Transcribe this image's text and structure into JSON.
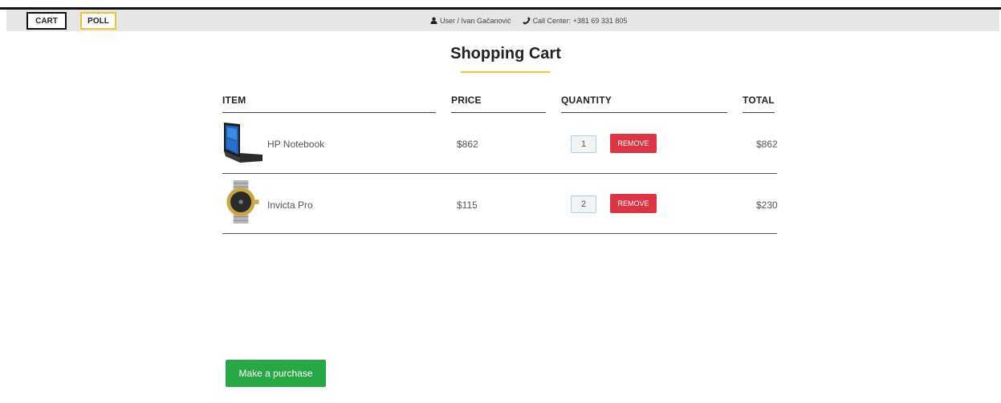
{
  "nav": {
    "cart_label": "CART",
    "poll_label": "POLL"
  },
  "contact": {
    "user_text": "User / Ivan Gačanović",
    "phone_text": "Call Center: +381 69 331 805"
  },
  "page": {
    "title": "Shopping Cart",
    "purchase_label": "Make a purchase"
  },
  "table": {
    "headers": [
      "ITEM",
      "PRICE",
      "QUANTITY",
      "TOTAL"
    ],
    "rows": [
      {
        "name": "HP Notebook",
        "price": "$862",
        "quantity": "1",
        "remove_label": "REMOVE",
        "total": "$862",
        "image": "laptop-image"
      },
      {
        "name": "Invicta Pro",
        "price": "$115",
        "quantity": "2",
        "remove_label": "REMOVE",
        "total": "$230",
        "image": "watch-image"
      }
    ]
  },
  "colors": {
    "accent": "#f2c230",
    "remove": "#dc3545",
    "purchase": "#28a745"
  }
}
